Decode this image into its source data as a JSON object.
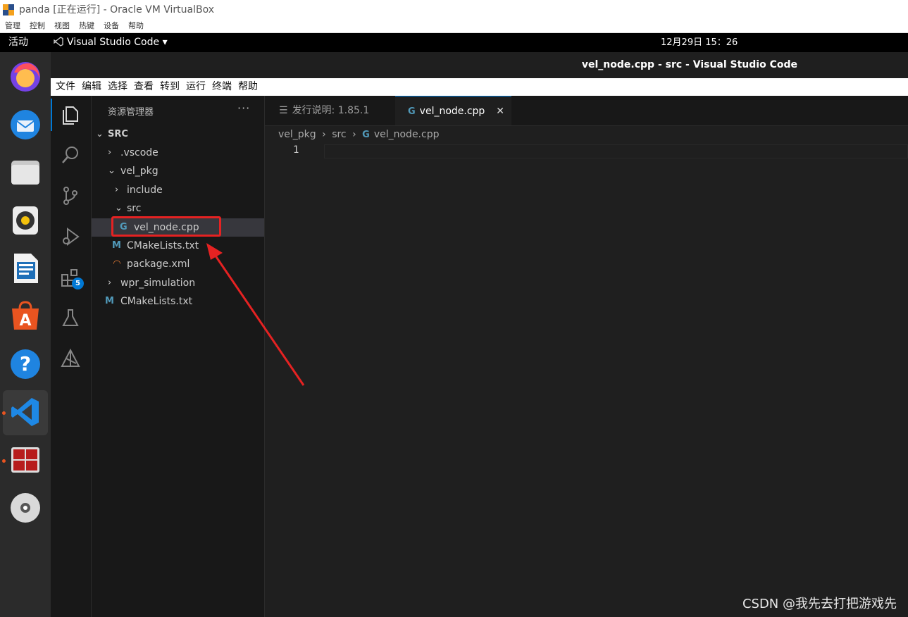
{
  "vbox": {
    "title": "panda [正在运行] - Oracle VM VirtualBox",
    "menu": [
      "管理",
      "控制",
      "视图",
      "热键",
      "设备",
      "帮助"
    ]
  },
  "gnome": {
    "activities": "活动",
    "app_name": "Visual Studio Code ▾",
    "clock": "12月29日  15：26"
  },
  "dock": {
    "items": [
      "firefox-icon",
      "thunderbird-icon",
      "files-icon",
      "rhythmbox-icon",
      "libreoffice-writer-icon",
      "app-center-icon",
      "help-icon",
      "vscode-icon",
      "terminator-icon",
      "dvd-icon"
    ]
  },
  "vscode": {
    "window_title": "vel_node.cpp - src - Visual Studio Code",
    "menu": [
      "文件",
      "编辑",
      "选择",
      "查看",
      "转到",
      "运行",
      "终端",
      "帮助"
    ],
    "extensions_badge": "5",
    "explorer": {
      "title": "资源管理器",
      "more": "···",
      "root": "SRC",
      "rows": [
        {
          "label": ".vscode",
          "chevron": "›",
          "icon": ""
        },
        {
          "label": "vel_pkg",
          "chevron": "⌄",
          "icon": ""
        },
        {
          "label": "include",
          "chevron": "›",
          "icon": ""
        },
        {
          "label": "src",
          "chevron": "⌄",
          "icon": ""
        },
        {
          "label": "vel_node.cpp",
          "chevron": "",
          "icon": "G"
        },
        {
          "label": "CMakeLists.txt",
          "chevron": "",
          "icon": "M"
        },
        {
          "label": "package.xml",
          "chevron": "",
          "icon": "◠"
        },
        {
          "label": "wpr_simulation",
          "chevron": "›",
          "icon": ""
        },
        {
          "label": "CMakeLists.txt",
          "chevron": "",
          "icon": "M"
        }
      ]
    },
    "tabs": [
      {
        "label": "发行说明: 1.85.1",
        "icon": "☰"
      },
      {
        "label": "vel_node.cpp",
        "icon": "G",
        "close": "✕"
      }
    ],
    "breadcrumb": {
      "a": "vel_pkg",
      "b": "src",
      "c": "vel_node.cpp",
      "sep": "›"
    },
    "editor": {
      "line_number": "1"
    }
  },
  "watermark": "CSDN @我先去打把游戏先",
  "colors": {
    "accent": "#0078d4",
    "annotation": "#e52222",
    "cpp": "#519aba",
    "cmake": "#519aba",
    "xml": "#e37933"
  }
}
